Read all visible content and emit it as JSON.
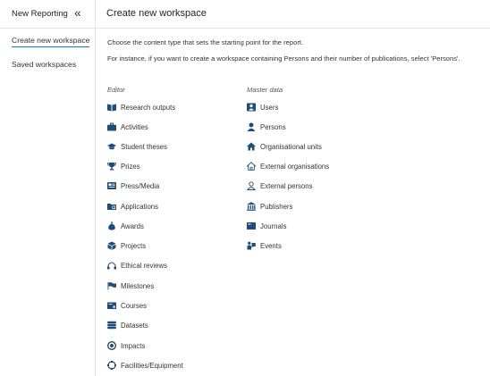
{
  "colors": {
    "icon": "#1f4d7a",
    "accent": "#1a73c8"
  },
  "sidebar": {
    "title": "New Reporting",
    "collapse_glyph": "«",
    "items": [
      {
        "label": "Create new workspace"
      },
      {
        "label": "Saved workspaces"
      }
    ]
  },
  "header": {
    "title": "Create new workspace"
  },
  "intro": {
    "line1": "Choose the content type that sets the starting point for the report.",
    "line2": "For instance, if you want to create a workspace containing Persons and their number of publications, select 'Persons'."
  },
  "editor": {
    "heading": "Editor",
    "items": [
      {
        "label": "Research outputs",
        "icon": "book-icon"
      },
      {
        "label": "Activities",
        "icon": "briefcase-icon"
      },
      {
        "label": "Student theses",
        "icon": "graduation-cap-icon"
      },
      {
        "label": "Prizes",
        "icon": "trophy-icon"
      },
      {
        "label": "Press/Media",
        "icon": "newspaper-icon"
      },
      {
        "label": "Applications",
        "icon": "application-icon"
      },
      {
        "label": "Awards",
        "icon": "money-bag-icon"
      },
      {
        "label": "Projects",
        "icon": "cube-icon"
      },
      {
        "label": "Ethical reviews",
        "icon": "scale-icon"
      },
      {
        "label": "Milestones",
        "icon": "flag-icon"
      },
      {
        "label": "Courses",
        "icon": "course-icon"
      },
      {
        "label": "Datasets",
        "icon": "database-icon"
      },
      {
        "label": "Impacts",
        "icon": "target-icon"
      },
      {
        "label": "Facilities/Equipment",
        "icon": "equipment-icon"
      }
    ]
  },
  "master": {
    "heading": "Master data",
    "items": [
      {
        "label": "Users",
        "icon": "users-icon"
      },
      {
        "label": "Persons",
        "icon": "person-icon"
      },
      {
        "label": "Organisational units",
        "icon": "house-icon"
      },
      {
        "label": "External organisations",
        "icon": "external-house-icon"
      },
      {
        "label": "External persons",
        "icon": "external-person-icon"
      },
      {
        "label": "Publishers",
        "icon": "building-icon"
      },
      {
        "label": "Journals",
        "icon": "journal-icon"
      },
      {
        "label": "Events",
        "icon": "event-icon"
      }
    ]
  }
}
